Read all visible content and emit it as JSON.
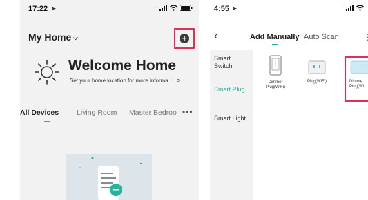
{
  "left_screen": {
    "status": {
      "time": "17:22"
    },
    "header": {
      "title": "My Home"
    },
    "welcome": {
      "title": "Welcome Home",
      "subtitle": "Set your home location for more informa..."
    },
    "tabs": [
      "All Devices",
      "Living Room",
      "Master Bedroo"
    ]
  },
  "right_screen": {
    "status": {
      "time": "4:55"
    },
    "tabs": {
      "active": "Add Manually",
      "inactive": "Auto Scan"
    },
    "sidebar": {
      "items": [
        {
          "label_line1": "Smart",
          "label_line2": "Switch"
        },
        {
          "label_line1": "Smart Plug",
          "label_line2": ""
        },
        {
          "label_line1": "Smart Light",
          "label_line2": ""
        }
      ]
    },
    "products": [
      {
        "line1": "Dimmer",
        "line2": "Plug(WiFi)"
      },
      {
        "line1": "Plug(WiFi)",
        "line2": ""
      },
      {
        "line1": "Dimme",
        "line2": "Plug(Wi"
      }
    ]
  },
  "colors": {
    "accent": "#2bb3a0",
    "highlight_border": "#d9335a",
    "background_gray": "#f2f2f3"
  }
}
